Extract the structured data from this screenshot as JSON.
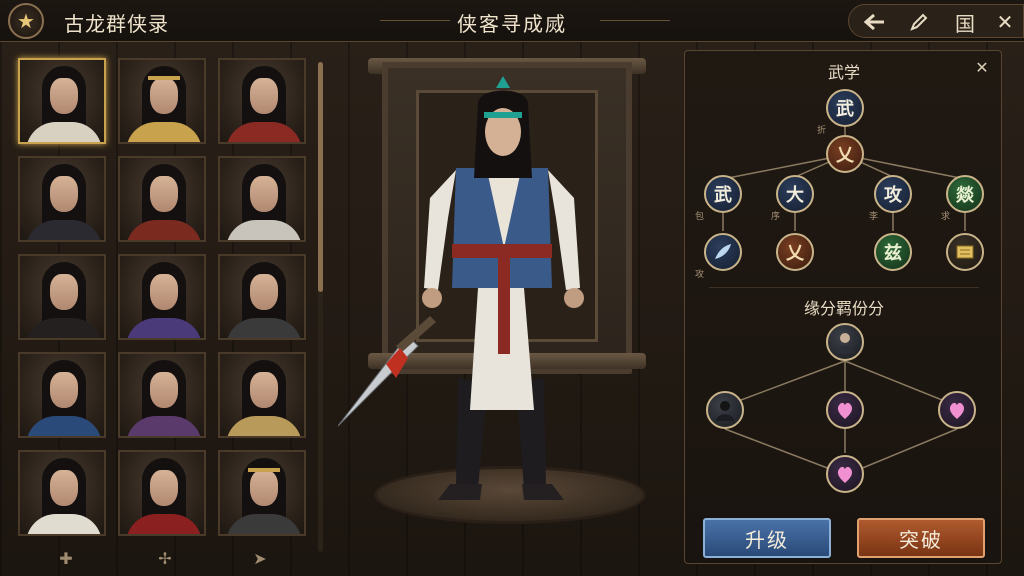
{
  "header": {
    "game_title": "古龙群侠录",
    "page_title": "侠客寻成烕",
    "logo_icon": "star-badge-icon",
    "actions": [
      {
        "name": "back-arrow-icon",
        "glyph": "🡐"
      },
      {
        "name": "edit-pencil-icon",
        "glyph": "✎"
      },
      {
        "name": "kingdom-glyph-icon",
        "glyph": "国"
      },
      {
        "name": "close-icon",
        "glyph": "✕"
      }
    ]
  },
  "roster": {
    "portraits": [
      {
        "robe": "#d8d0c0",
        "band": false,
        "selected": true
      },
      {
        "robe": "#c9a24e",
        "band": true,
        "selected": false
      },
      {
        "robe": "#8a2a22",
        "band": false,
        "selected": false
      },
      {
        "robe": "#2a2a30",
        "band": false,
        "selected": false
      },
      {
        "robe": "#7a2a1e",
        "band": false,
        "selected": false
      },
      {
        "robe": "#c8c4bc",
        "band": false,
        "selected": false
      },
      {
        "robe": "#242020",
        "band": false,
        "selected": false
      },
      {
        "robe": "#4a3a7a",
        "band": false,
        "selected": false
      },
      {
        "robe": "#3a3a3a",
        "band": false,
        "selected": false
      },
      {
        "robe": "#2a4a7a",
        "band": false,
        "selected": false
      },
      {
        "robe": "#5a3a6a",
        "band": false,
        "selected": false
      },
      {
        "robe": "#b89a5a",
        "band": false,
        "selected": false
      },
      {
        "robe": "#e0dcd0",
        "band": false,
        "selected": false
      },
      {
        "robe": "#8a2020",
        "band": false,
        "selected": false
      },
      {
        "robe": "#3a3a3a",
        "band": true,
        "selected": false
      }
    ],
    "nav": [
      "✚",
      "✢",
      "➤"
    ]
  },
  "panel": {
    "skills_title": "武学",
    "bond_title": "缘分羁份分",
    "close_glyph": "✕",
    "skill_nodes": [
      {
        "text": "武",
        "style": "blue",
        "label": "折"
      },
      {
        "text": "乂",
        "style": "brown",
        "label": ""
      },
      {
        "text": "武",
        "style": "blue",
        "label": "包"
      },
      {
        "text": "大",
        "style": "blue",
        "label": "序"
      },
      {
        "text": "攻",
        "style": "blue",
        "label": "李"
      },
      {
        "text": "燚",
        "style": "green",
        "label": "求"
      },
      {
        "text": "",
        "style": "blue",
        "label": "攻"
      },
      {
        "text": "乂",
        "style": "brown",
        "label": ""
      },
      {
        "text": "兹",
        "style": "green",
        "label": ""
      },
      {
        "text": "",
        "style": "gold",
        "label": ""
      }
    ],
    "bond_nodes": [
      {
        "style": "person"
      },
      {
        "style": "person"
      },
      {
        "style": "pink"
      },
      {
        "style": "pink"
      },
      {
        "style": "pink"
      }
    ],
    "upgrade_label": "升级",
    "breakthrough_label": "突破"
  },
  "colors": {
    "accent_gold": "#c9a24e",
    "upgrade_blue": "#2a4a78",
    "breakthrough_orange": "#7a3414"
  }
}
